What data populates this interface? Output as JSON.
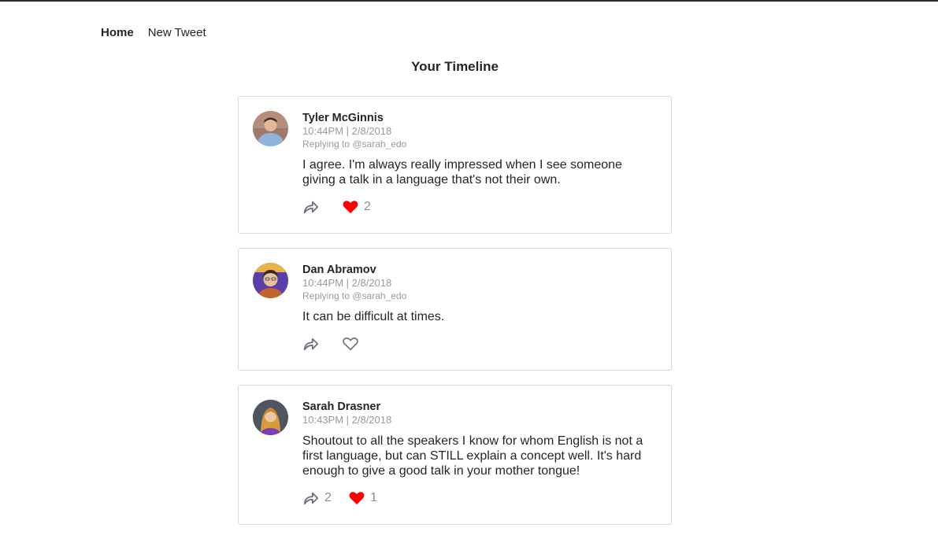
{
  "nav": {
    "home_label": "Home",
    "new_tweet_label": "New Tweet"
  },
  "page": {
    "title": "Your Timeline"
  },
  "colors": {
    "like_active": "#e0245e",
    "icon_gray": "#7c7f8a",
    "text": "#252525",
    "muted": "#9a9a9a"
  },
  "tweets": [
    {
      "author": "Tyler McGinnis",
      "timestamp": "10:44PM | 2/8/2018",
      "replying_to": "Replying to @sarah_edo",
      "text": "I agree. I'm always really impressed when I see someone giving a talk in a language that's not their own.",
      "reply_count": "",
      "like_count": "2",
      "liked": true,
      "reply_icon": "reply-arrow-icon",
      "like_icon": "heart-filled-icon"
    },
    {
      "author": "Dan Abramov",
      "timestamp": "10:44PM | 2/8/2018",
      "replying_to": "Replying to @sarah_edo",
      "text": "It can be difficult at times.",
      "reply_count": "",
      "like_count": "",
      "liked": false,
      "reply_icon": "reply-arrow-icon",
      "like_icon": "heart-outline-icon"
    },
    {
      "author": "Sarah Drasner",
      "timestamp": "10:43PM | 2/8/2018",
      "replying_to": "",
      "text": "Shoutout to all the speakers I know for whom English is not a first language, but can STILL explain a concept well. It's hard enough to give a good talk in your mother tongue!",
      "reply_count": "2",
      "like_count": "1",
      "liked": true,
      "reply_icon": "reply-arrow-icon",
      "like_icon": "heart-filled-icon"
    }
  ]
}
